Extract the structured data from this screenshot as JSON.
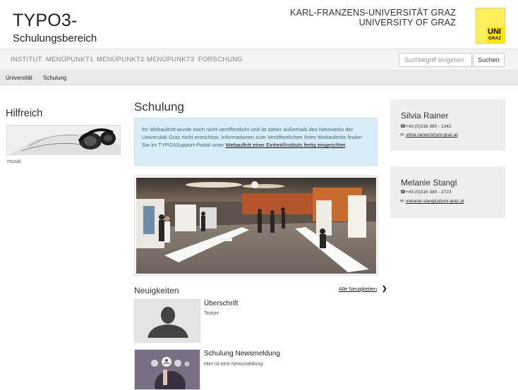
{
  "header": {
    "title_line1": "TYPO3-",
    "title_line2": "Schulungsbereich",
    "university_line1": "KARL-FRANZENS-UNIVERSITÄT GRAZ",
    "university_line2": "UNIVERSITY OF GRAZ",
    "logo_line1": "UNI",
    "logo_line2": "GRAZ",
    "logo_color": "#fde500"
  },
  "nav": {
    "items": [
      "INSTITUT",
      "MENÜPUNKT1",
      "MENÜPUNKT2",
      "MENÜPUNKT3",
      "FORSCHUNG"
    ]
  },
  "search": {
    "placeholder": "Suchbegriff eingeben",
    "button_label": "Suchen"
  },
  "breadcrumb": {
    "items": [
      "Universität",
      "Schulung"
    ]
  },
  "sidebar": {
    "heading": "Hilfreich",
    "image_caption": "musik"
  },
  "main": {
    "title": "Schulung",
    "info_text": "Ihr Webauftritt wurde noch nicht veröffentlicht und ist daher außerhalb des Netzwerks der Universität Graz nicht erreichbar. Informationen zum Veröffentlichen Ihres Webauftritts finden Sie im TYPO3Support-Portal unter",
    "info_link": "Webauftritt einer Einheit/Instituts fertig eingerichtet",
    "info_tail": ".",
    "info_color": "#d8edf5"
  },
  "news": {
    "heading": "Neuigkeiten",
    "all_link": "Alle Neuigkeiten",
    "items": [
      {
        "title": "Überschrift",
        "teaser": "Teaser"
      },
      {
        "title": "Schulung Newsmeldung",
        "teaser": "Hier ist eine Newsmeldung"
      }
    ]
  },
  "contacts": [
    {
      "name": "Silvia Rainer",
      "phone": "+43 (0)316 380 - 1342",
      "email": "silvia.rainer(at)uni-graz.at"
    },
    {
      "name": "Melanie Stangl",
      "phone": "+43 (0)316 380 - 2723",
      "email": "melanie.stangl(at)uni-graz.at"
    }
  ]
}
